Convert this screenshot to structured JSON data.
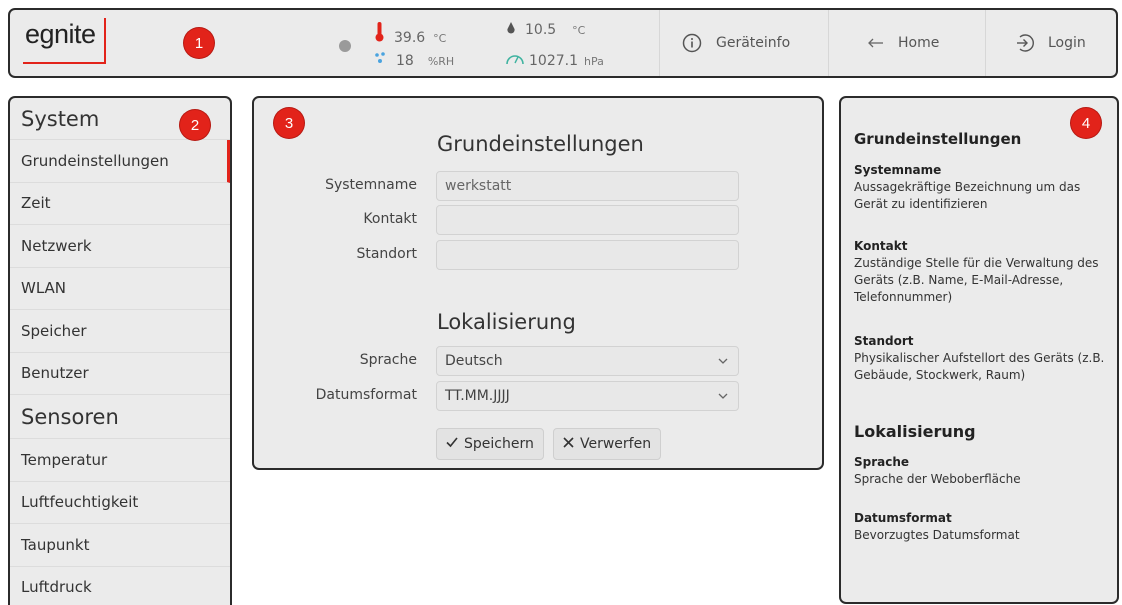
{
  "header": {
    "logo_text": "egnite",
    "markers": [
      "1",
      "2",
      "3",
      "4"
    ],
    "readings": {
      "temperature": {
        "value": "39.6",
        "unit": "°C"
      },
      "dewpoint": {
        "value": "10.5",
        "unit": "°C"
      },
      "humidity": {
        "value": "18",
        "unit": "%RH"
      },
      "pressure": {
        "value": "1027.1",
        "unit": "hPa"
      }
    },
    "nav": {
      "info_label": "Geräteinfo",
      "home_label": "Home",
      "login_label": "Login"
    }
  },
  "sidebar": {
    "system_heading": "System",
    "system_items": [
      "Grundeinstellungen",
      "Zeit",
      "Netzwerk",
      "WLAN",
      "Speicher",
      "Benutzer"
    ],
    "sensors_heading": "Sensoren",
    "sensor_items": [
      "Temperatur",
      "Luftfeuchtigkeit",
      "Taupunkt",
      "Luftdruck"
    ]
  },
  "form": {
    "basic_title": "Grundeinstellungen",
    "fields": {
      "systemname": {
        "label": "Systemname",
        "value": "werkstatt"
      },
      "kontakt": {
        "label": "Kontakt",
        "value": ""
      },
      "standort": {
        "label": "Standort",
        "value": ""
      }
    },
    "localization_title": "Lokalisierung",
    "sprache": {
      "label": "Sprache",
      "value": "Deutsch"
    },
    "datumsformat": {
      "label": "Datumsformat",
      "value": "TT.MM.JJJJ"
    },
    "save_label": "Speichern",
    "discard_label": "Verwerfen"
  },
  "help": {
    "basic_title": "Grundeinstellungen",
    "systemname_term": "Systemname",
    "systemname_desc": "Aussagekräftige Bezeichnung um das Gerät zu identifizieren",
    "kontakt_term": "Kontakt",
    "kontakt_desc": "Zuständige Stelle für die Verwaltung des Geräts (z.B. Name, E-Mail-Adresse, Telefonnummer)",
    "standort_term": "Standort",
    "standort_desc": "Physikalischer Aufstellort des Geräts (z.B. Gebäude, Stockwerk, Raum)",
    "localization_title": "Lokalisierung",
    "sprache_term": "Sprache",
    "sprache_desc": "Sprache der Weboberfläche",
    "datumsformat_term": "Datumsformat",
    "datumsformat_desc": "Bevorzugtes Datumsformat"
  },
  "colors": {
    "accent": "#e2231a",
    "panel_bg": "#ebebeb",
    "border": "#2b2b2b"
  }
}
